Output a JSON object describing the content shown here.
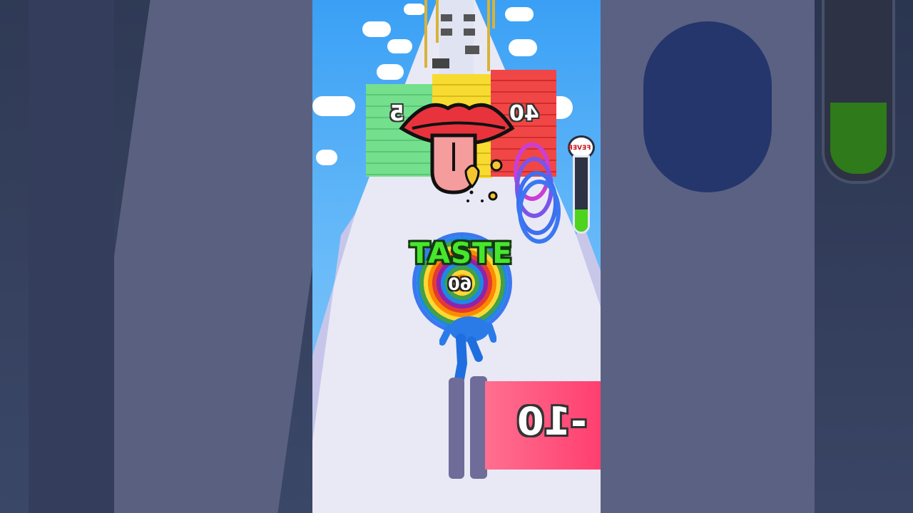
{
  "game": {
    "wall_left_value": "5",
    "wall_right_value": "40",
    "action_word": "TASTE",
    "player_count": "60",
    "gate_value": "-10",
    "fever_label": "FEVER",
    "fever_level": 0.3
  },
  "icons": {
    "lips": "lips-tongue-icon"
  },
  "colors": {
    "sky": "#4aaaf6",
    "wall_green": "#6fdc8a",
    "wall_yellow": "#f6d62a",
    "wall_red": "#ef3b3b",
    "taste_green": "#46e62d",
    "gate_pink": "#ff3f6f",
    "fever_green": "#4ed41c"
  }
}
